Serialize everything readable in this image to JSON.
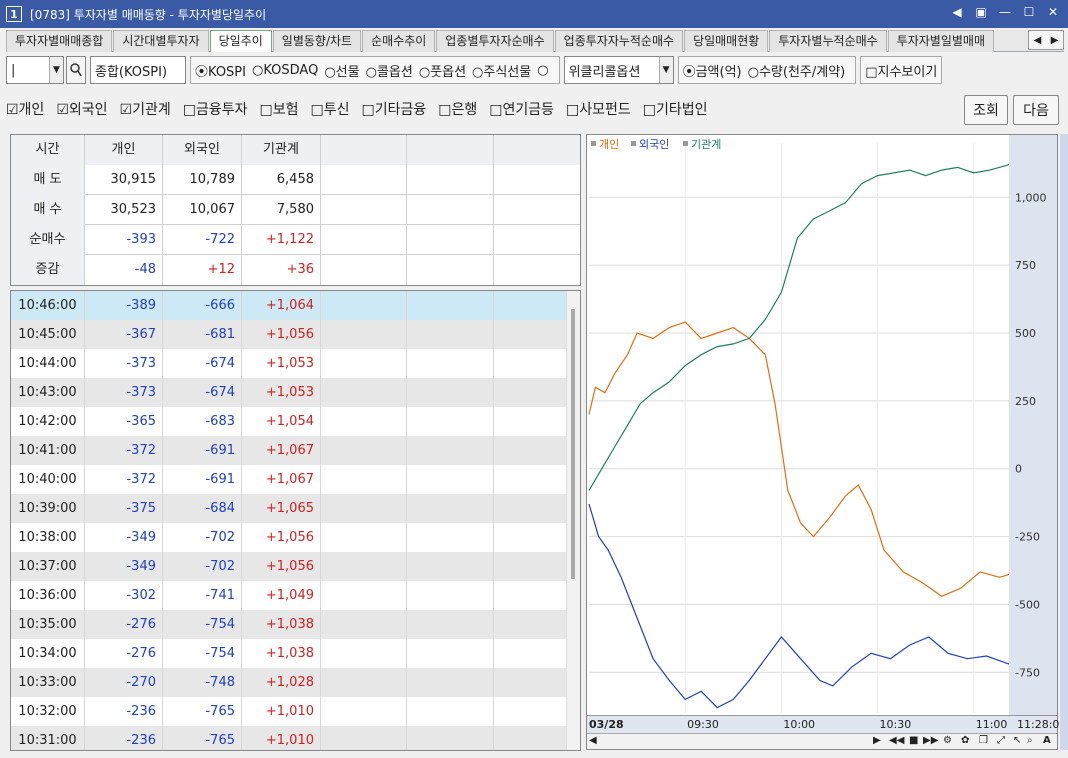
{
  "window": {
    "number": "1",
    "title": "[0783] 투자자별 매매동향 - 투자자별당일추이"
  },
  "tabs": [
    "투자자별매매종합",
    "시간대별투자자",
    "당일추이",
    "일별동향/차트",
    "순매수추이",
    "업종별투자자순매수",
    "업종투자자누적순매수",
    "당일매매현황",
    "투자자별누적순매수",
    "투자자별일별매매"
  ],
  "active_tab": "당일추이",
  "toolbar": {
    "code_value": "|",
    "market_combo": "종합(KOSPI)",
    "market_radios": [
      "⦿KOSPI",
      "○KOSDAQ",
      "○선물",
      "○콜옵션",
      "○풋옵션",
      "○주식선물",
      "○"
    ],
    "weekly_combo": "위클리콜옵션",
    "unit_radios": [
      "⦿금액(억)",
      "○수량(천주/계약)"
    ],
    "show_index": "□지수보이기"
  },
  "filters": [
    "☑개인",
    "☑외국인",
    "☑기관계",
    "□금융투자",
    "□보험",
    "□투신",
    "□기타금융",
    "□은행",
    "□연기금등",
    "□사모펀드",
    "□기타법인"
  ],
  "buttons": {
    "query": "조회",
    "next": "다음"
  },
  "summary": {
    "headers": [
      "시간",
      "개인",
      "외국인",
      "기관계",
      "",
      "",
      ""
    ],
    "rows": [
      {
        "label": "매 도",
        "v": [
          "30,915",
          "10,789",
          "6,458"
        ]
      },
      {
        "label": "매 수",
        "v": [
          "30,523",
          "10,067",
          "7,580"
        ]
      },
      {
        "label": "순매수",
        "v": [
          "-393",
          "-722",
          "+1,122"
        ]
      },
      {
        "label": "증감",
        "v": [
          "-48",
          "+12",
          "+36"
        ]
      }
    ]
  },
  "list": [
    [
      "10:46:00",
      "-389",
      "-666",
      "+1,064"
    ],
    [
      "10:45:00",
      "-367",
      "-681",
      "+1,056"
    ],
    [
      "10:44:00",
      "-373",
      "-674",
      "+1,053"
    ],
    [
      "10:43:00",
      "-373",
      "-674",
      "+1,053"
    ],
    [
      "10:42:00",
      "-365",
      "-683",
      "+1,054"
    ],
    [
      "10:41:00",
      "-372",
      "-691",
      "+1,067"
    ],
    [
      "10:40:00",
      "-372",
      "-691",
      "+1,067"
    ],
    [
      "10:39:00",
      "-375",
      "-684",
      "+1,065"
    ],
    [
      "10:38:00",
      "-349",
      "-702",
      "+1,056"
    ],
    [
      "10:37:00",
      "-349",
      "-702",
      "+1,056"
    ],
    [
      "10:36:00",
      "-302",
      "-741",
      "+1,049"
    ],
    [
      "10:35:00",
      "-276",
      "-754",
      "+1,038"
    ],
    [
      "10:34:00",
      "-276",
      "-754",
      "+1,038"
    ],
    [
      "10:33:00",
      "-270",
      "-748",
      "+1,028"
    ],
    [
      "10:32:00",
      "-236",
      "-765",
      "+1,010"
    ],
    [
      "10:31:00",
      "-236",
      "-765",
      "+1,010"
    ]
  ],
  "colors": {
    "individual": "#e07010",
    "foreign": "#2040c0",
    "institution": "#208060"
  },
  "chart_data": {
    "type": "line",
    "legend": [
      "개인",
      "외국인",
      "기관계"
    ],
    "x_ticks": [
      "03/28",
      "09:30",
      "10:00",
      "10:30",
      "11:00",
      "11:28:0"
    ],
    "y_ticks": [
      "1,000",
      "750",
      "500",
      "250",
      "0",
      "-250",
      "-500",
      "-750"
    ],
    "ylim": [
      -900,
      1200
    ],
    "x_range_minutes": [
      0,
      131
    ],
    "series": [
      {
        "name": "개인",
        "points": [
          [
            0,
            200
          ],
          [
            2,
            300
          ],
          [
            5,
            280
          ],
          [
            8,
            350
          ],
          [
            12,
            420
          ],
          [
            15,
            500
          ],
          [
            20,
            480
          ],
          [
            25,
            520
          ],
          [
            30,
            540
          ],
          [
            35,
            480
          ],
          [
            40,
            500
          ],
          [
            45,
            520
          ],
          [
            50,
            480
          ],
          [
            55,
            420
          ],
          [
            58,
            240
          ],
          [
            62,
            -80
          ],
          [
            66,
            -200
          ],
          [
            70,
            -250
          ],
          [
            75,
            -180
          ],
          [
            80,
            -100
          ],
          [
            84,
            -60
          ],
          [
            88,
            -150
          ],
          [
            92,
            -300
          ],
          [
            98,
            -380
          ],
          [
            104,
            -420
          ],
          [
            110,
            -470
          ],
          [
            116,
            -440
          ],
          [
            122,
            -380
          ],
          [
            128,
            -400
          ],
          [
            131,
            -390
          ]
        ]
      },
      {
        "name": "외국인",
        "points": [
          [
            0,
            -130
          ],
          [
            3,
            -250
          ],
          [
            6,
            -300
          ],
          [
            10,
            -400
          ],
          [
            15,
            -550
          ],
          [
            20,
            -700
          ],
          [
            25,
            -780
          ],
          [
            30,
            -850
          ],
          [
            35,
            -820
          ],
          [
            40,
            -880
          ],
          [
            45,
            -850
          ],
          [
            50,
            -780
          ],
          [
            55,
            -700
          ],
          [
            60,
            -620
          ],
          [
            66,
            -700
          ],
          [
            72,
            -780
          ],
          [
            76,
            -800
          ],
          [
            82,
            -730
          ],
          [
            88,
            -680
          ],
          [
            94,
            -700
          ],
          [
            100,
            -650
          ],
          [
            106,
            -620
          ],
          [
            112,
            -680
          ],
          [
            118,
            -700
          ],
          [
            124,
            -690
          ],
          [
            131,
            -720
          ]
        ]
      },
      {
        "name": "기관계",
        "points": [
          [
            0,
            -80
          ],
          [
            4,
            0
          ],
          [
            8,
            80
          ],
          [
            12,
            160
          ],
          [
            16,
            240
          ],
          [
            20,
            280
          ],
          [
            25,
            320
          ],
          [
            30,
            380
          ],
          [
            35,
            420
          ],
          [
            40,
            450
          ],
          [
            45,
            460
          ],
          [
            50,
            480
          ],
          [
            55,
            550
          ],
          [
            60,
            650
          ],
          [
            65,
            850
          ],
          [
            70,
            920
          ],
          [
            75,
            950
          ],
          [
            80,
            980
          ],
          [
            85,
            1050
          ],
          [
            90,
            1080
          ],
          [
            95,
            1090
          ],
          [
            100,
            1100
          ],
          [
            105,
            1080
          ],
          [
            110,
            1100
          ],
          [
            115,
            1110
          ],
          [
            120,
            1090
          ],
          [
            125,
            1100
          ],
          [
            131,
            1120
          ]
        ]
      }
    ]
  }
}
